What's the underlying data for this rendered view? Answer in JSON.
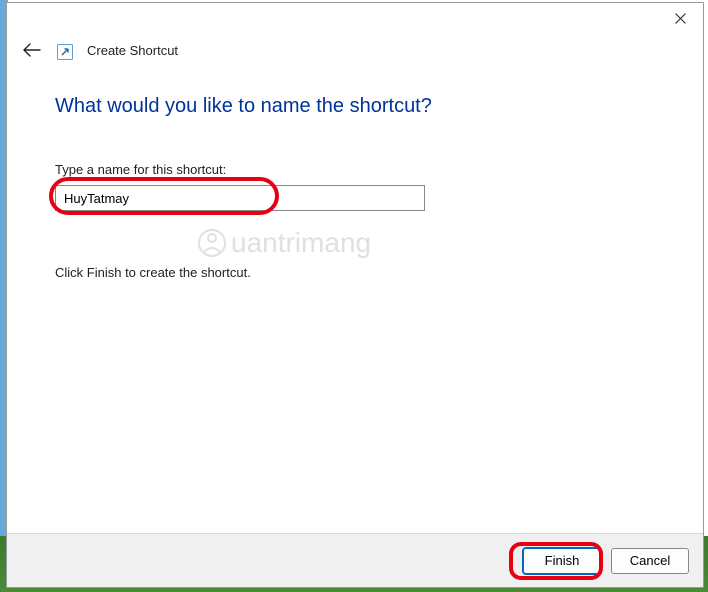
{
  "header": {
    "title": "Create Shortcut"
  },
  "content": {
    "heading": "What would you like to name the shortcut?",
    "input_label": "Type a name for this shortcut:",
    "input_value": "HuyTatmay",
    "instruction": "Click Finish to create the shortcut."
  },
  "footer": {
    "finish_label": "Finish",
    "cancel_label": "Cancel"
  },
  "watermark": {
    "text": "uantrimang"
  }
}
